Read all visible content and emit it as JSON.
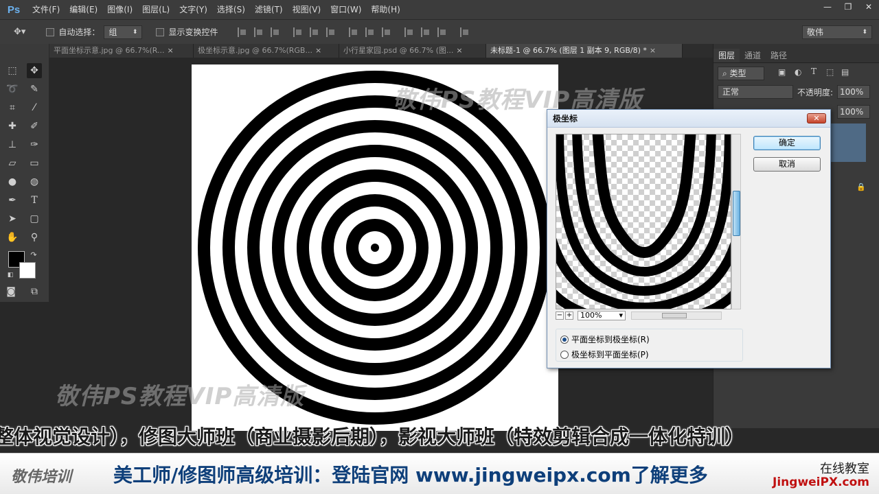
{
  "app": {
    "logo": "Ps"
  },
  "menu": [
    "文件(F)",
    "编辑(E)",
    "图像(I)",
    "图层(L)",
    "文字(Y)",
    "选择(S)",
    "滤镜(T)",
    "视图(V)",
    "窗口(W)",
    "帮助(H)"
  ],
  "window_controls": {
    "minimize": "—",
    "restore": "❐",
    "close": "✕"
  },
  "options": {
    "auto_select_label": "自动选择：",
    "auto_select_value": "组",
    "show_transform_label": "显示变换控件",
    "workspace": "敬伟"
  },
  "tabs": [
    {
      "label": "平面坐标示意.jpg @ 66.7%(R...",
      "active": false
    },
    {
      "label": "极坐标示意.jpg @ 66.7%(RGB...",
      "active": false
    },
    {
      "label": "小行星家园.psd @ 66.7% (图...",
      "active": false
    },
    {
      "label": "未标题-1 @ 66.7% (图层 1 副本 9, RGB/8) *",
      "active": true
    }
  ],
  "tab_close": "×",
  "panels": {
    "tabs": [
      "图层",
      "通道",
      "路径"
    ],
    "kind_filter": "类型",
    "blend_mode": "正常",
    "opacity_label": "不透明度:",
    "opacity_value": "100%",
    "fill_value": "100%"
  },
  "dialog": {
    "title": "极坐标",
    "close": "✕",
    "ok": "确定",
    "cancel": "取消",
    "zoom": "100%",
    "zoom_out": "−",
    "zoom_in": "+",
    "option_rect_to_polar": "平面坐标到极坐标(R)",
    "option_polar_to_rect": "极坐标到平面坐标(P)",
    "selected_option": "rect_to_polar"
  },
  "watermark": "敬伟PS教程VIP高清版",
  "subtitle": "整体视觉设计），修图大师班（商业摄影后期），影视大师班（特效剪辑合成一体化特训）",
  "banner": {
    "logo": "敬伟培训",
    "main": "美工师/修图师高级培训：登陆官网 www.jingweipx.com了解更多",
    "right_1": "在线教室",
    "right_2": "JingweiPX.com"
  }
}
